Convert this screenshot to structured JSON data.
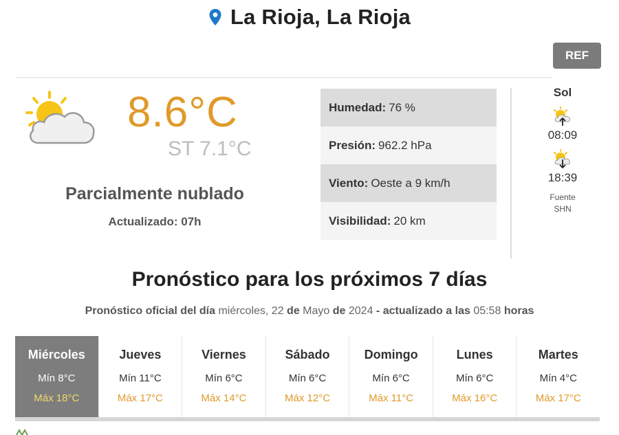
{
  "header": {
    "location": "La Rioja, La Rioja",
    "ref_label": "REF"
  },
  "current": {
    "temperature": "8.6°C",
    "feels_like": "ST 7.1°C",
    "condition": "Parcialmente nublado",
    "updated": "Actualizado: 07h",
    "icon": "partly-cloudy-icon"
  },
  "details": [
    {
      "label": "Humedad:",
      "value": "76 %"
    },
    {
      "label": "Presión:",
      "value": "962.2 hPa"
    },
    {
      "label": "Viento:",
      "value": "Oeste a 9 km/h"
    },
    {
      "label": "Visibilidad:",
      "value": "20 km"
    }
  ],
  "sun": {
    "title": "Sol",
    "sunrise": "08:09",
    "sunset": "18:39",
    "source_line1": "Fuente",
    "source_line2": "SHN"
  },
  "forecast": {
    "title": "Pronóstico para los próximos 7 días",
    "subtitle": {
      "p1": "Pronóstico oficial del día",
      "weekday": "miércoles,",
      "day": "22",
      "p2": "de",
      "month": "Mayo",
      "p3": "de",
      "year": "2024",
      "p4": "- actualizado a las",
      "time": "05:58",
      "p5": "horas"
    },
    "days": [
      {
        "name": "Miércoles",
        "min": "Mín 8°C",
        "max": "Máx 18°C"
      },
      {
        "name": "Jueves",
        "min": "Mín 11°C",
        "max": "Máx 17°C"
      },
      {
        "name": "Viernes",
        "min": "Mín 6°C",
        "max": "Máx 14°C"
      },
      {
        "name": "Sábado",
        "min": "Mín 6°C",
        "max": "Máx 12°C"
      },
      {
        "name": "Domingo",
        "min": "Mín 6°C",
        "max": "Máx 11°C"
      },
      {
        "name": "Lunes",
        "min": "Mín 6°C",
        "max": "Máx 16°C"
      },
      {
        "name": "Martes",
        "min": "Mín 4°C",
        "max": "Máx 17°C"
      }
    ]
  },
  "colors": {
    "accent": "#e09a2a",
    "pin": "#1e78c8",
    "active_day": "#7d7d7d",
    "ref_button": "#7b7b7b"
  }
}
